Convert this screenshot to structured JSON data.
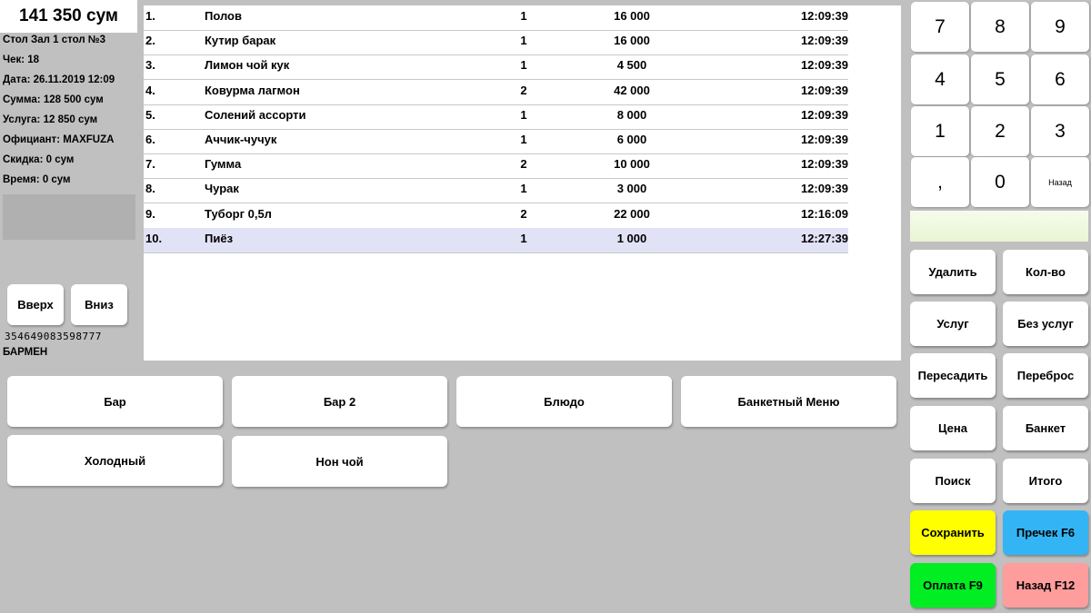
{
  "summary": {
    "total": "141 350 сум",
    "table": "Стол Зал 1 стол №3",
    "check": "Чек: 18",
    "date": "Дата: 26.11.2019 12:09",
    "sum": "Сумма: 128 500 сум",
    "service": "Услуга: 12 850 сум",
    "waiter": "Официант: MAXFUZA",
    "discount": "Скидка: 0 сум",
    "time": "Время: 0 сум"
  },
  "nav": {
    "up": "Вверх",
    "down": "Вниз"
  },
  "barcode": "354649083598777",
  "role": "БАРМЕН",
  "order_items": [
    {
      "num": "1.",
      "name": "Полов",
      "qty": "1",
      "price": "16 000",
      "time": "12:09:39"
    },
    {
      "num": "2.",
      "name": "Кутир барак",
      "qty": "1",
      "price": "16 000",
      "time": "12:09:39"
    },
    {
      "num": "3.",
      "name": "Лимон чой кук",
      "qty": "1",
      "price": "4 500",
      "time": "12:09:39"
    },
    {
      "num": "4.",
      "name": "Ковурма лагмон",
      "qty": "2",
      "price": "42 000",
      "time": "12:09:39"
    },
    {
      "num": "5.",
      "name": "Солений ассорти",
      "qty": "1",
      "price": "8 000",
      "time": "12:09:39"
    },
    {
      "num": "6.",
      "name": "Аччик-чучук",
      "qty": "1",
      "price": "6 000",
      "time": "12:09:39"
    },
    {
      "num": "7.",
      "name": "Гумма",
      "qty": "2",
      "price": "10 000",
      "time": "12:09:39"
    },
    {
      "num": "8.",
      "name": "Чурак",
      "qty": "1",
      "price": "3 000",
      "time": "12:09:39"
    },
    {
      "num": "9.",
      "name": "Туборг 0,5л",
      "qty": "2",
      "price": "22 000",
      "time": "12:16:09"
    },
    {
      "num": "10.",
      "name": "Пиёз",
      "qty": "1",
      "price": "1 000",
      "time": "12:27:39",
      "selected": true
    }
  ],
  "categories": [
    "Бар",
    "Бар 2",
    "Блюдо",
    "Банкетный Меню",
    "Холодный",
    "Нон чой"
  ],
  "keypad": [
    "7",
    "8",
    "9",
    "4",
    "5",
    "6",
    "1",
    "2",
    "3",
    ",",
    "0",
    "Назад"
  ],
  "actions": [
    {
      "label": "Удалить",
      "color": "#ffffff"
    },
    {
      "label": "Кол-во",
      "color": "#ffffff"
    },
    {
      "label": "Услуг",
      "color": "#ffffff"
    },
    {
      "label": "Без услуг",
      "color": "#ffffff"
    },
    {
      "label": "Пересадить",
      "color": "#ffffff"
    },
    {
      "label": "Переброс",
      "color": "#ffffff"
    },
    {
      "label": "Цена",
      "color": "#ffffff"
    },
    {
      "label": "Банкет",
      "color": "#ffffff"
    },
    {
      "label": "Поиск",
      "color": "#ffffff"
    },
    {
      "label": "Итого",
      "color": "#ffffff"
    },
    {
      "label": "Сохранить",
      "color": "#ffff00"
    },
    {
      "label": "Пречек F6",
      "color": "#33b5f5"
    },
    {
      "label": "Оплата F9",
      "color": "#00ee22"
    },
    {
      "label": "Назад F12",
      "color": "#ff9c9c"
    }
  ]
}
